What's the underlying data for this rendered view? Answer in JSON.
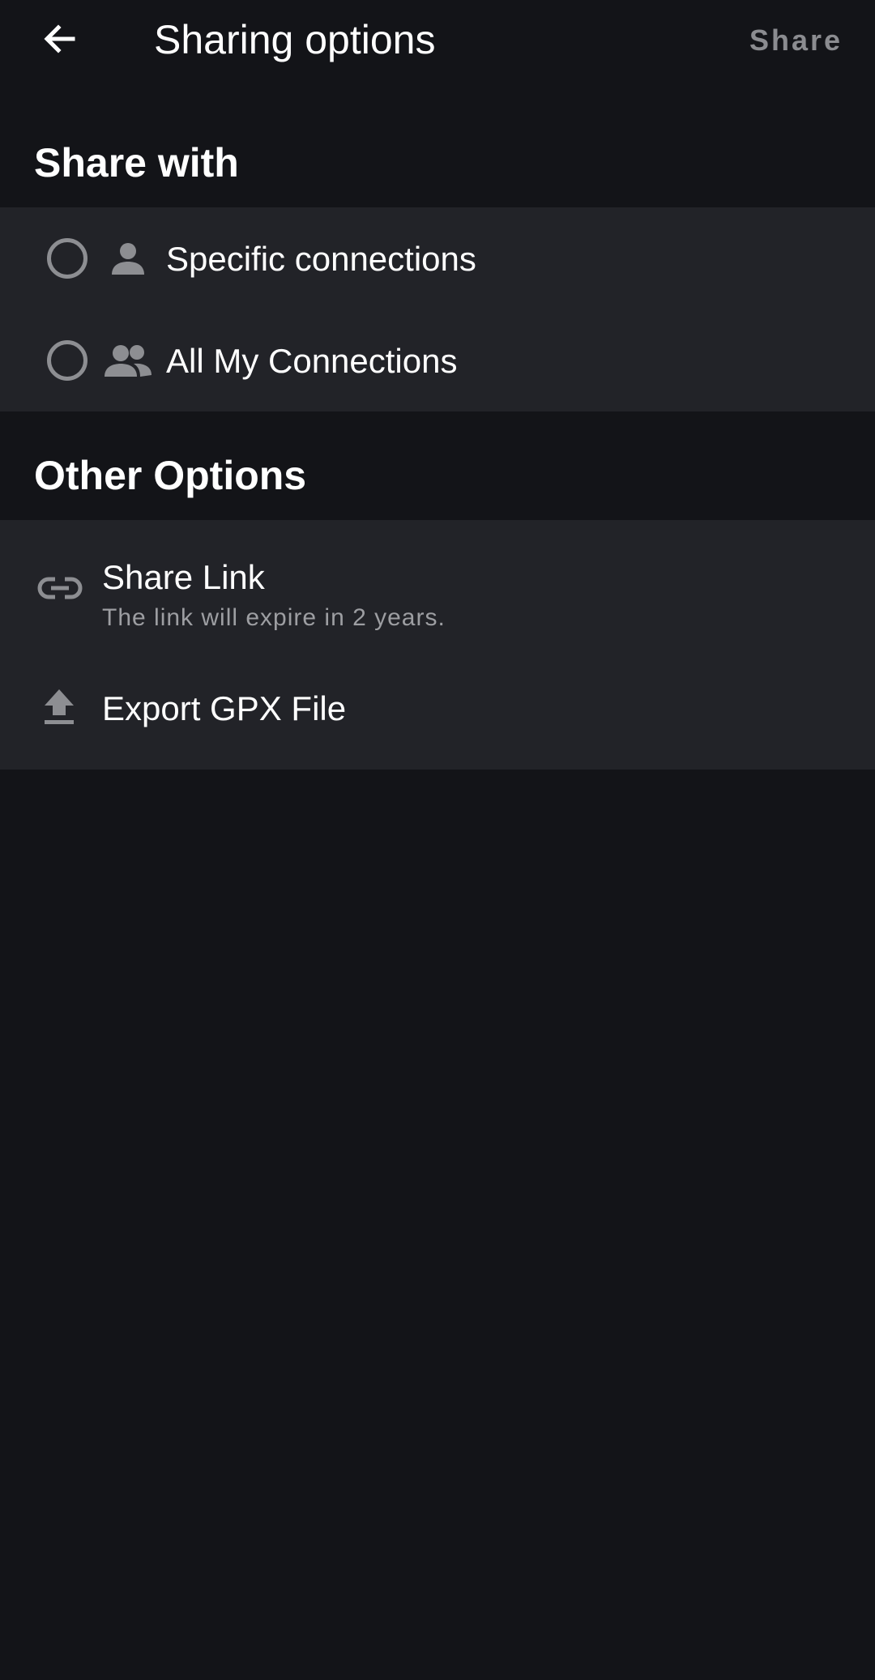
{
  "app_bar": {
    "back_icon": "arrow-back-icon",
    "title": "Sharing options",
    "action_label": "Share"
  },
  "share_with": {
    "header": "Share with",
    "options": [
      {
        "label": "Specific connections",
        "icon": "person-icon",
        "selected": false
      },
      {
        "label": "All My Connections",
        "icon": "people-icon",
        "selected": false
      }
    ]
  },
  "other_options": {
    "header": "Other Options",
    "items": [
      {
        "label": "Share Link",
        "subtitle": "The link will expire in 2 years.",
        "icon": "link-icon"
      },
      {
        "label": "Export GPX File",
        "icon": "upload-icon"
      }
    ]
  },
  "colors": {
    "background": "#131418",
    "card": "#222328",
    "text_primary": "#ffffff",
    "text_secondary": "#9d9ea2",
    "icon": "#8d8e92"
  }
}
